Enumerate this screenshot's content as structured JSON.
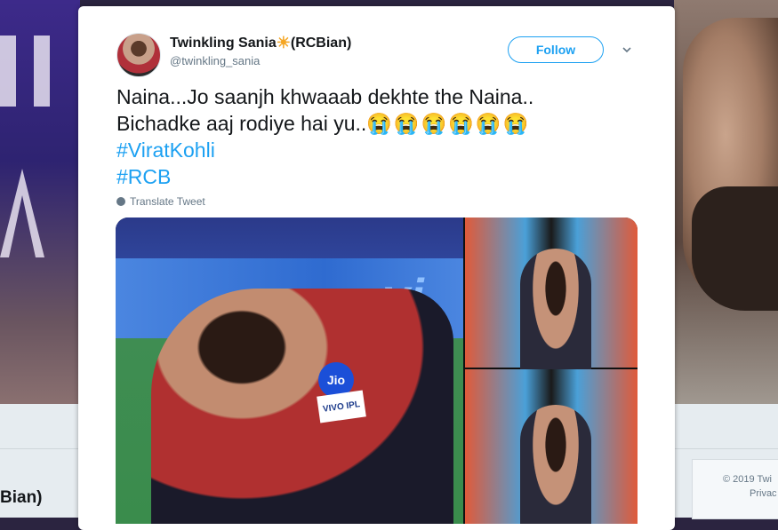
{
  "background": {
    "partial_name": "Bian)",
    "footer_copyright": "© 2019 Twi",
    "footer_privacy": "Privac"
  },
  "tweet": {
    "display_name": "Twinkling Sania",
    "name_emoji": "☀",
    "name_suffix": "(RCBian)",
    "handle": "@twinkling_sania",
    "follow_label": "Follow",
    "line1": "Naina...Jo saanjh khwaaab dekhte the Naina..",
    "line2": "Bichadke aaj rodiye hai yu..",
    "line2_emojis": "😭😭😭😭😭😭",
    "hashtags": [
      "#ViratKohli",
      "#RCB"
    ],
    "translate_label": "Translate Tweet",
    "media_text": {
      "sponsor": "vi",
      "jersey_logo": "Jio",
      "jersey_badge": "VIVO IPL"
    }
  },
  "colors": {
    "accent": "#1da1f2",
    "text": "#14171a",
    "muted": "#657786"
  },
  "icons": {
    "chevron": "chevron-down-icon",
    "globe": "globe-icon"
  }
}
